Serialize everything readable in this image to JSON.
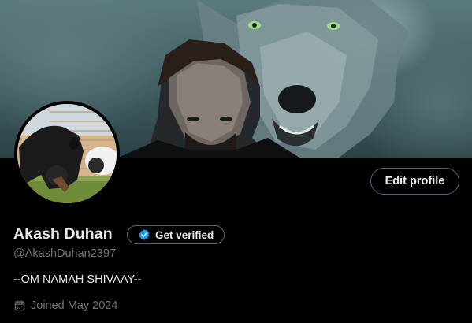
{
  "profile": {
    "display_name": "Akash Duhan",
    "handle": "@AkashDuhan2397",
    "bio": "--OM NAMAH SHIVAAY--",
    "joined": "Joined May 2024"
  },
  "actions": {
    "edit_profile": "Edit profile",
    "get_verified": "Get verified"
  },
  "icons": {
    "verified": "verified-badge-icon",
    "calendar": "calendar-icon"
  },
  "colors": {
    "background": "#000000",
    "text_primary": "#e7e9ea",
    "text_secondary": "#71767b",
    "border": "#536471",
    "verified_blue": "#1d9bf0"
  }
}
